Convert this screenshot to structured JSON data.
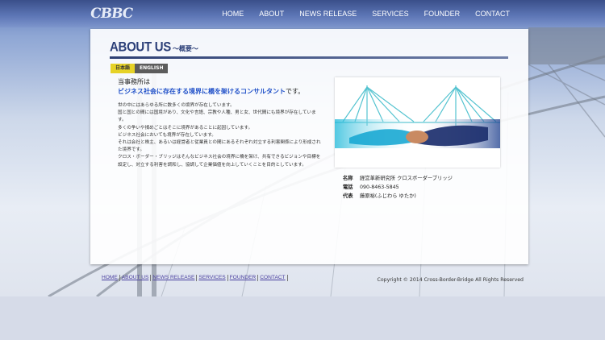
{
  "header": {
    "logo_text": "CBBC",
    "nav": [
      "HOME",
      "ABOUT",
      "NEWS RELEASE",
      "SERVICES",
      "FOUNDER",
      "CONTACT"
    ]
  },
  "main": {
    "title": "ABOUT US",
    "subtitle": "～概要～",
    "lang": {
      "ja": "日本語",
      "en": "ENGLISH"
    },
    "lead_line1": "当事務所は",
    "lead_line2_highlight": "ビジネス社会に存在する境界に橋を架けるコンサルタント",
    "lead_line2_suffix": "です。",
    "paragraphs": [
      "世の中にはあらゆる所に数多くの境界が存在しています。",
      "国と国との間には国境があり、文化や言語、宗教や人種、男と女、世代間にも境界が存在しています。",
      "多くの争いや揉めごとはそこに境界があることに起因しています。",
      "ビジネス社会においても境界が存在しています。",
      "それは会社と株主、あるいは経営者と従業員との間にあるそれぞれ対立する利害関係により形成された境界です。",
      "クロス・ボーダー・ブリッジはそんなビジネス社会の境界に橋を架け、共有できるビジョンや目標を設定し、対立する利害を調和し、協調して企業価値を向上していくことを目的としています。"
    ],
    "info": [
      {
        "label": "名称",
        "value": "経営革新研究所 クロスボーダーブリッジ"
      },
      {
        "label": "電話",
        "value": "090-8463-5845"
      },
      {
        "label": "代表",
        "value": "藤原裕(ふじわら ゆたか)"
      }
    ]
  },
  "footer": {
    "links": [
      "HOME",
      "ABOUT US",
      "NEWS RELEASE",
      "SERVICES",
      "FOUNDER",
      "CONTACT"
    ],
    "copyright": "Copyright © 2014 Cross-Border-Bridge All Rights Reserved"
  }
}
